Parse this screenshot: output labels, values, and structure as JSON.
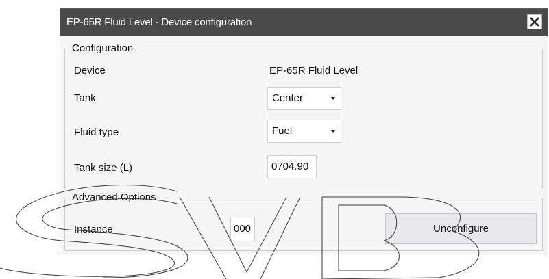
{
  "dialog": {
    "title": "EP-65R Fluid Level - Device configuration",
    "close_icon": "close-icon"
  },
  "configuration": {
    "legend": "Configuration",
    "device": {
      "label": "Device",
      "value": "EP-65R Fluid Level"
    },
    "tank": {
      "label": "Tank",
      "value": "Center",
      "icon": "chevron-down-icon"
    },
    "fluid_type": {
      "label": "Fluid type",
      "value": "Fuel",
      "icon": "chevron-down-icon"
    },
    "tank_size": {
      "label": "Tank size (L)",
      "value": "0704.90"
    }
  },
  "advanced": {
    "legend": "Advanced Options",
    "instance": {
      "label": "Instance",
      "value": "000"
    },
    "unconfigure_label": "Unconfigure"
  },
  "colors": {
    "titlebar": "#4a4a4a",
    "dialog_bg": "#f5f5f5",
    "button_bg": "#e8e8ec"
  }
}
